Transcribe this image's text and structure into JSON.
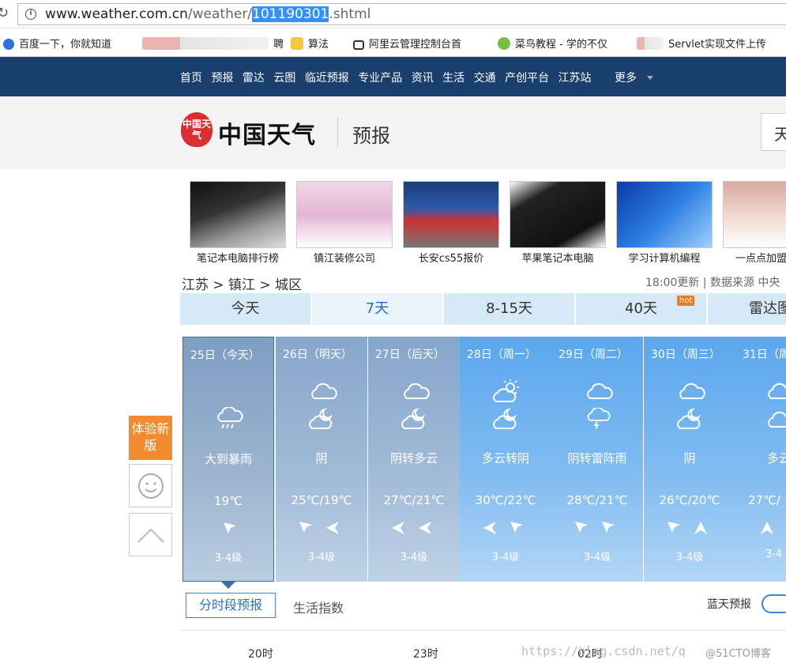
{
  "address_bar": {
    "url_host": "www.weather.com.cn",
    "url_path_before": "/weather/",
    "url_selected": "101190301",
    "url_path_after": ".shtml"
  },
  "bookmarks": [
    {
      "label": "百度一下，你就知道"
    },
    {
      "label": "聘"
    },
    {
      "label": "算法"
    },
    {
      "label": "阿里云管理控制台首"
    },
    {
      "label": "菜鸟教程 - 学的不仅"
    },
    {
      "label": "Servlet实现文件上传"
    }
  ],
  "nav": {
    "items": [
      "首页",
      "预报",
      "雷达",
      "云图",
      "临近预报",
      "专业产品",
      "资讯",
      "生活",
      "交通",
      "产创平台",
      "江苏站"
    ],
    "more": "更多"
  },
  "header": {
    "seal": "中国天气",
    "logo": "中国天气",
    "section": "预报",
    "search_stub": "天"
  },
  "ads": [
    {
      "caption": "笔记本电脑排行榜"
    },
    {
      "caption": "镇江装修公司"
    },
    {
      "caption": "长安cs55报价"
    },
    {
      "caption": "苹果笔记本电脑"
    },
    {
      "caption": "学习计算机编程"
    },
    {
      "caption": "一点点加盟"
    }
  ],
  "breadcrumb": "江苏 > 镇江 > 城区",
  "update": "18:00更新 | 数据来源 中央",
  "tabs": [
    {
      "label": "今天"
    },
    {
      "label": "7天"
    },
    {
      "label": "8-15天"
    },
    {
      "label": "40天"
    },
    {
      "label": "雷达图"
    }
  ],
  "hot_badge": "hot",
  "forecast": [
    {
      "date": "25日（今天）",
      "desc": "大到暴雨",
      "temp": "19℃",
      "level": "3-4级"
    },
    {
      "date": "26日（明天）",
      "desc": "阴",
      "temp": "25℃/19℃",
      "level": "3-4级"
    },
    {
      "date": "27日（后天）",
      "desc": "阴转多云",
      "temp": "27℃/21℃",
      "level": "3-4级"
    },
    {
      "date": "28日（周一）",
      "desc": "多云转阴",
      "temp": "30℃/22℃",
      "level": "3-4级"
    },
    {
      "date": "29日（周二）",
      "desc": "阴转雷阵雨",
      "temp": "28℃/21℃",
      "level": "3-4级"
    },
    {
      "date": "30日（周三）",
      "desc": "阴",
      "temp": "26℃/20℃",
      "level": "3-4级"
    },
    {
      "date": "31日（周",
      "desc": "多云",
      "temp": "27℃/",
      "level": "3-4"
    }
  ],
  "side": {
    "experience": "体验新版"
  },
  "subtabs": {
    "hourly": "分时段预报",
    "life": "生活指数",
    "blue_sky": "蓝天预报"
  },
  "hours": [
    "20时",
    "23时",
    "02时"
  ],
  "watermark": "https://blog.csdn.net/q",
  "watermark2": "@51CTO博客",
  "colors": {
    "nav": "#1a3f6d",
    "accent": "#3a87d5",
    "orange": "#f28a2e"
  }
}
